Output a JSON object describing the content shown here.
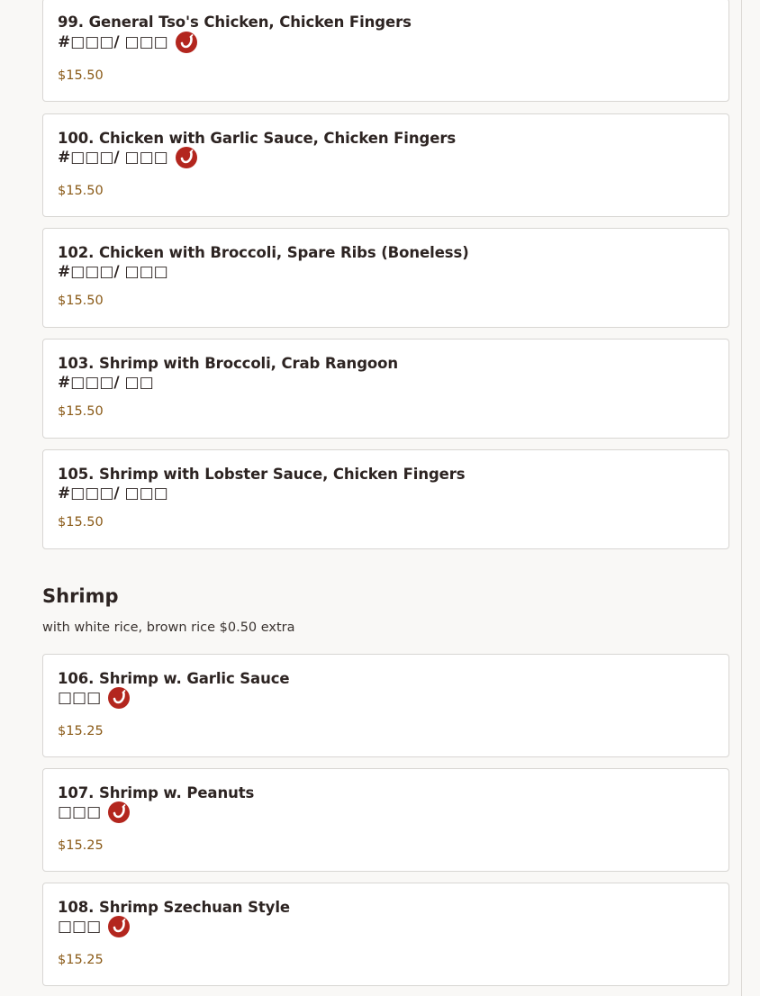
{
  "items_top": [
    {
      "title": "99. General Tso's Chicken, Chicken Fingers",
      "sub": "#□□□/ □□□",
      "spicy": true,
      "price": "$15.50"
    },
    {
      "title": "100. Chicken with Garlic Sauce, Chicken Fingers",
      "sub": "#□□□/ □□□",
      "spicy": true,
      "price": "$15.50"
    },
    {
      "title": "102. Chicken with Broccoli, Spare Ribs (Boneless)",
      "sub": "#□□□/ □□□",
      "spicy": false,
      "price": "$15.50"
    },
    {
      "title": "103. Shrimp with Broccoli, Crab Rangoon",
      "sub": "#□□□/ □□",
      "spicy": false,
      "price": "$15.50"
    },
    {
      "title": "105. Shrimp with Lobster Sauce, Chicken Fingers",
      "sub": "#□□□/ □□□",
      "spicy": false,
      "price": "$15.50"
    }
  ],
  "section": {
    "title": "Shrimp",
    "description": "with white rice, brown rice $0.50 extra"
  },
  "items_shrimp": [
    {
      "title": "106. Shrimp w. Garlic Sauce",
      "sub": "□□□",
      "spicy": true,
      "price": "$15.25"
    },
    {
      "title": "107. Shrimp w. Peanuts",
      "sub": "□□□",
      "spicy": true,
      "price": "$15.25"
    },
    {
      "title": "108. Shrimp Szechuan Style",
      "sub": "□□□",
      "spicy": true,
      "price": "$15.25"
    }
  ],
  "colors": {
    "price": "#8a5a17",
    "spicy_badge": "#b3261e",
    "background": "#f9f8f6"
  },
  "icons": {
    "spicy": "chili-pepper-icon"
  }
}
